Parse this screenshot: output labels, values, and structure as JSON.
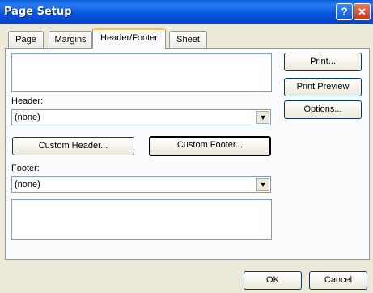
{
  "window": {
    "title": "Page Setup"
  },
  "tabs": [
    {
      "label": "Page"
    },
    {
      "label": "Margins"
    },
    {
      "label": "Header/Footer"
    },
    {
      "label": "Sheet"
    }
  ],
  "header": {
    "label": "Header:",
    "value": "(none)"
  },
  "footer": {
    "label": "Footer:",
    "value": "(none)"
  },
  "buttons": {
    "custom_header": "Custom Header...",
    "custom_footer": "Custom Footer...",
    "print": "Print...",
    "print_preview": "Print Preview",
    "options": "Options...",
    "ok": "OK",
    "cancel": "Cancel"
  }
}
